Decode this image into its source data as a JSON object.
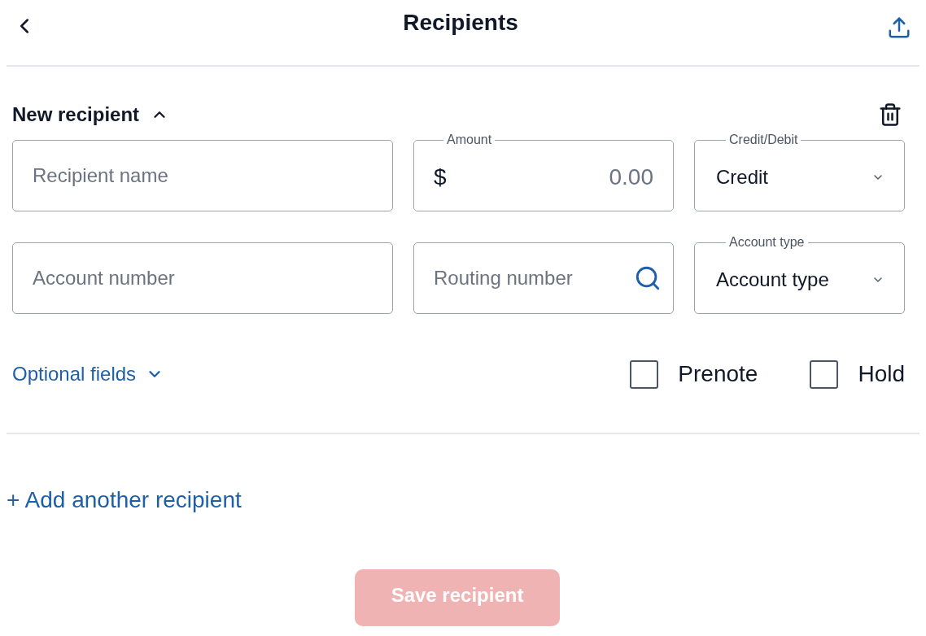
{
  "header": {
    "title": "Recipients"
  },
  "recipient": {
    "title": "New recipient",
    "expanded": true,
    "fields": [
      {
        "kind": "text",
        "placeholder": "Recipient name"
      },
      {
        "kind": "amount",
        "label": "Amount",
        "prefix": "$",
        "placeholder": "0.00"
      },
      {
        "kind": "select",
        "label": "Credit/Debit",
        "value": "Credit"
      },
      {
        "kind": "text",
        "placeholder": "Account number"
      },
      {
        "kind": "search",
        "placeholder": "Routing number"
      },
      {
        "kind": "select",
        "label": "Account type",
        "value": "Account type"
      }
    ],
    "optional_fields": {
      "label": "Optional fields",
      "expanded": false
    },
    "checkboxes": [
      {
        "label": "Prenote",
        "checked": false
      },
      {
        "label": "Hold",
        "checked": false
      }
    ]
  },
  "add_link": "+ Add another recipient",
  "save_button": {
    "label": "Save recipient",
    "disabled": true
  }
}
